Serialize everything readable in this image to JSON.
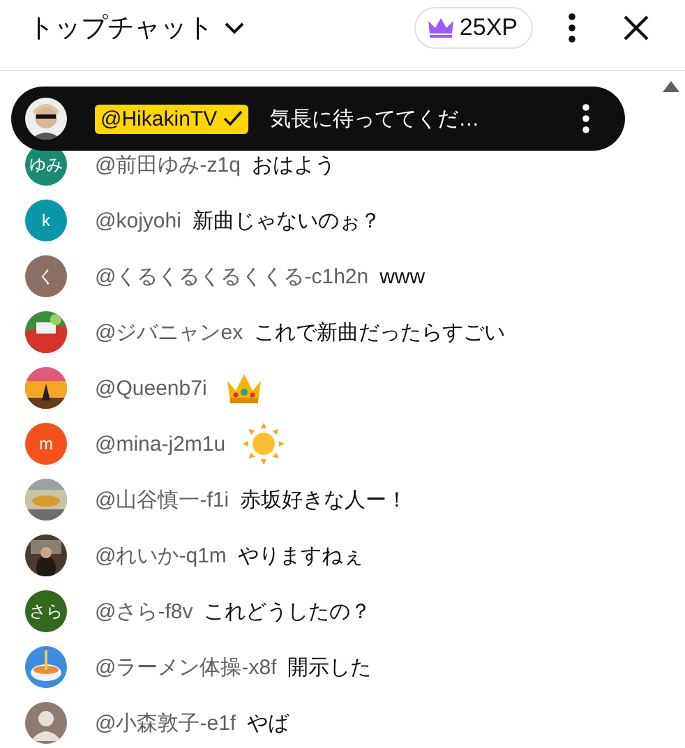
{
  "header": {
    "title": "トップチャット",
    "xp": "25XP"
  },
  "pinned": {
    "author": "@HikakinTV",
    "verified": true,
    "message": "気長に待っててくだ…"
  },
  "messages": [
    {
      "author": "@前田ゆみ-z1q",
      "avatar": {
        "kind": "letter",
        "text": "ゆみ",
        "color": "#1b8a73"
      },
      "kind": "text",
      "text": "おはよう"
    },
    {
      "author": "@kojyohi",
      "avatar": {
        "kind": "letter",
        "text": "k",
        "color": "#0a97a8"
      },
      "kind": "text",
      "text": "新曲じゃないのぉ？"
    },
    {
      "author": "@くるくるくるくくる-c1h2n",
      "avatar": {
        "kind": "letter",
        "text": "く",
        "color": "#8d6e63"
      },
      "kind": "text",
      "text": "www"
    },
    {
      "author": "@ジバニャンex",
      "kind": "text",
      "text": "これで新曲だったらすごい"
    },
    {
      "author": "@Queenb7i",
      "kind": "crown"
    },
    {
      "author": "@mina-j2m1u",
      "avatar": {
        "kind": "letter",
        "text": "m",
        "color": "#f4511e"
      },
      "kind": "sun"
    },
    {
      "author": "@山谷慎一-f1i",
      "kind": "text",
      "text": "赤坂好きな人ー！"
    },
    {
      "author": "@れいか-q1m",
      "kind": "text",
      "text": "やりますねぇ"
    },
    {
      "author": "@さら-f8v",
      "avatar": {
        "kind": "letter",
        "text": "さら",
        "color": "#33691e"
      },
      "kind": "text",
      "text": "これどうしたの？"
    },
    {
      "author": "@ラーメン体操-x8f",
      "kind": "text",
      "text": "開示した"
    },
    {
      "author": "@小森敦子-e1f",
      "avatar": {
        "kind": "silhouette"
      },
      "kind": "text",
      "text": "やば"
    }
  ]
}
